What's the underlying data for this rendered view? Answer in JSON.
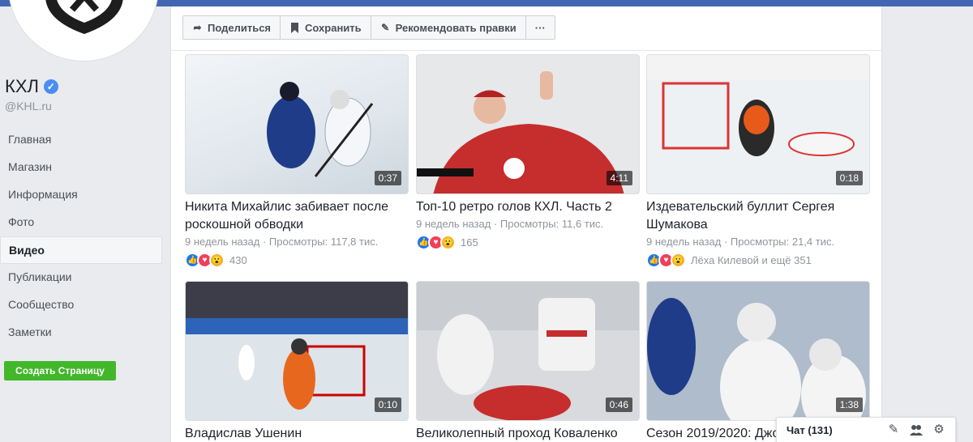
{
  "page": {
    "name": "КХЛ",
    "handle": "@KHL.ru",
    "verified_icon": "verified-badge-icon"
  },
  "nav": {
    "items": [
      {
        "label": "Главная"
      },
      {
        "label": "Магазин"
      },
      {
        "label": "Информация"
      },
      {
        "label": "Фото"
      },
      {
        "label": "Видео",
        "active": true
      },
      {
        "label": "Публикации"
      },
      {
        "label": "Сообщество"
      },
      {
        "label": "Заметки"
      }
    ],
    "create_page_label": "Создать Страницу"
  },
  "actions": {
    "share": "Поделиться",
    "save": "Сохранить",
    "suggest": "Рекомендовать правки",
    "more": "···"
  },
  "videos": [
    {
      "title": "Никита Михайлис забивает после роскошной обводки",
      "meta": "9 недель назад · Просмотры: 117,8 тис.",
      "duration": "0:37",
      "reactions": "430",
      "thumb_color": "#dfe7ee"
    },
    {
      "title": "Топ-10 ретро голов КХЛ. Часть 2",
      "meta": "9 недель назад · Просмотры: 11,6 тис.",
      "duration": "4:11",
      "reactions": "165",
      "thumb_color": "#c62d2d"
    },
    {
      "title": "Издевательский буллит Сергея Шумакова",
      "meta": "9 недель назад · Просмотры: 21,4 тис.",
      "duration": "0:18",
      "reactions": "Лёха Килевой и ещё 351",
      "thumb_color": "#e8ecef"
    },
    {
      "title": "Владислав Ушенин",
      "meta": "",
      "duration": "0:10",
      "reactions": "",
      "thumb_color": "#cfd8e2"
    },
    {
      "title": "Великолепный проход Коваленко",
      "meta": "",
      "duration": "0:46",
      "reactions": "",
      "thumb_color": "#d7d9dc"
    },
    {
      "title": "Сезон 2019/2020: Джо",
      "meta": "",
      "duration": "1:38",
      "reactions": "",
      "thumb_color": "#b7c2cf"
    }
  ],
  "chat": {
    "label": "Чат (131)"
  },
  "colors": {
    "brand": "#4267b2",
    "create_button": "#42b72a"
  }
}
